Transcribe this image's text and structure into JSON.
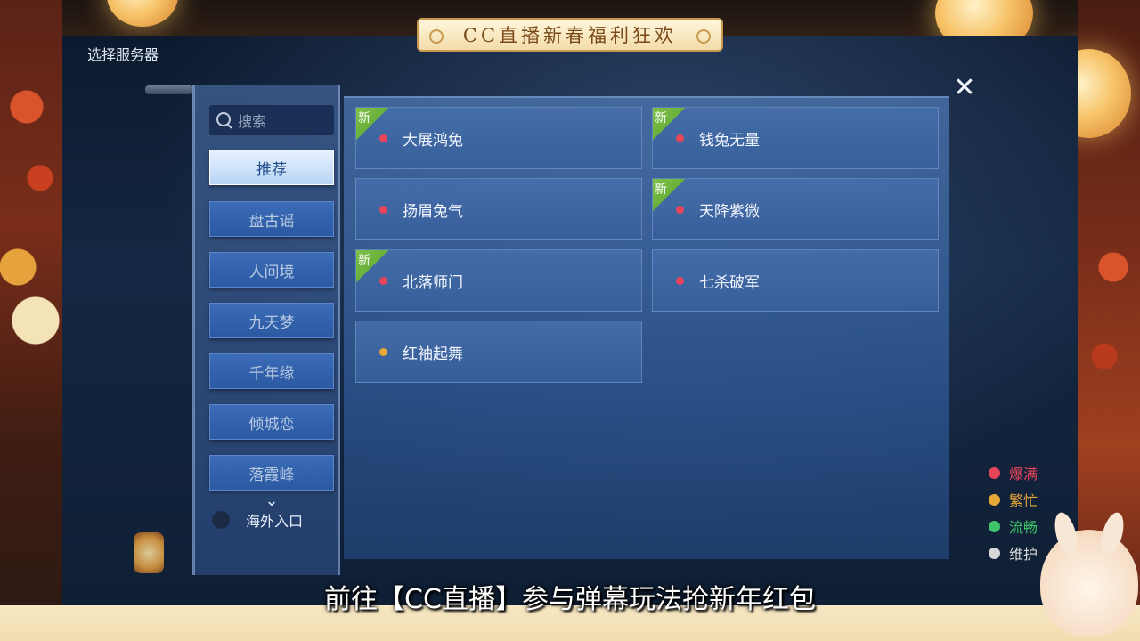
{
  "banner": {
    "text": "CC直播新春福利狂欢"
  },
  "window": {
    "title": "选择服务器",
    "close_label": "✕"
  },
  "search": {
    "placeholder": "搜索"
  },
  "categories": [
    {
      "label": "推荐",
      "active": true
    },
    {
      "label": "盘古谣",
      "active": false
    },
    {
      "label": "人间境",
      "active": false
    },
    {
      "label": "九天梦",
      "active": false
    },
    {
      "label": "千年缘",
      "active": false
    },
    {
      "label": "倾城恋",
      "active": false
    },
    {
      "label": "落霞峰",
      "active": false
    }
  ],
  "scroll_chevron": "⌄",
  "overseas": {
    "label": "海外入口"
  },
  "new_tag_label": "新",
  "servers": [
    {
      "name": "大展鸿兔",
      "status": "爆满",
      "is_new": true
    },
    {
      "name": "钱兔无量",
      "status": "爆满",
      "is_new": true
    },
    {
      "name": "扬眉兔气",
      "status": "爆满",
      "is_new": false
    },
    {
      "name": "天降紫微",
      "status": "爆满",
      "is_new": true
    },
    {
      "name": "北落师门",
      "status": "爆满",
      "is_new": true
    },
    {
      "name": "七杀破军",
      "status": "爆满",
      "is_new": false
    },
    {
      "name": "红袖起舞",
      "status": "繁忙",
      "is_new": false
    }
  ],
  "legend": [
    {
      "label": "爆满",
      "color": "#e8445a"
    },
    {
      "label": "繁忙",
      "color": "#e8a838"
    },
    {
      "label": "流畅",
      "color": "#3ec46a"
    },
    {
      "label": "维护",
      "color": "#d8d8d8"
    }
  ],
  "subtitle": "前往【CC直播】参与弹幕玩法抢新年红包"
}
